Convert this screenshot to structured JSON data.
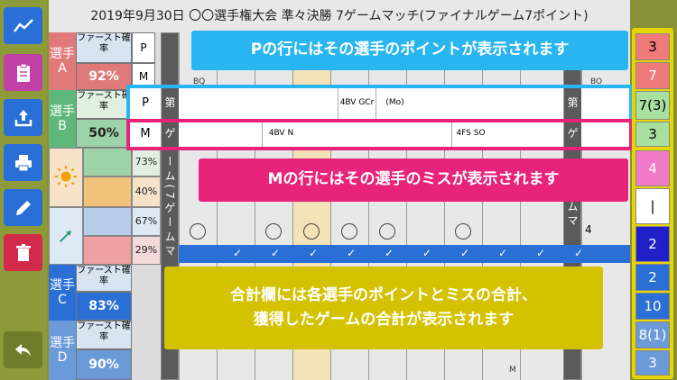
{
  "title": "2019年9月30日 〇〇選手権大会 準々決勝 7ゲームマッチ(ファイナルゲーム7ポイント)",
  "toolbar": {
    "colors": {
      "chart": "#2a6fd6",
      "clipboard": "#c040a8",
      "upload": "#2a6fd6",
      "print": "#2a6fd6",
      "pencil": "#2a6fd6",
      "trash": "#d22a4a",
      "back": "#7a8a2a"
    }
  },
  "players": [
    {
      "label": "選手A",
      "first_label": "ファースト確率",
      "rate": "92%",
      "p": "P",
      "m": "M",
      "rate_color": "#e07a7a"
    },
    {
      "label": "選手B",
      "first_label": "ファースト確率",
      "rate": "50%",
      "p": "P",
      "m": "M",
      "rate_color": "#5fb87a"
    },
    {
      "label": "選手C",
      "first_label": "ファースト確率",
      "rate": "83%",
      "p": "",
      "m": "",
      "rate_color": "#2a6fd6"
    },
    {
      "label": "選手D",
      "first_label": "ファースト確率",
      "rate": "90%",
      "p": "",
      "m": "",
      "rate_color": "#6a9ad8"
    }
  ],
  "game_label": "第1ゲーム(7ゲームマッチ)",
  "game_label_short": "第",
  "game_label_ge": "ゲ",
  "game_vertical": "ー ム ( 7 ゲ ー ム マ",
  "game_vertical_right": "ー ム マ",
  "cells": {
    "b_p_notes": [
      "4BV GCr",
      "(Mo)"
    ],
    "b_m_notes": [
      "4BV N",
      "4FS SO"
    ],
    "a_m_note": "BQ",
    "a_m_note2": "BO",
    "d_m_note": "M",
    "row_num": "4"
  },
  "percents": [
    "73%",
    "40%",
    "67%",
    "29%"
  ],
  "scores": [
    {
      "value": "3",
      "bg": "#f07a7a"
    },
    {
      "value": "7",
      "bg": "#f07a7a"
    },
    {
      "value": "7(3)",
      "bg": "#a8e0a0"
    },
    {
      "value": "3",
      "bg": "#a8e0a0"
    },
    {
      "value": "4",
      "bg": "#f07ac8"
    },
    {
      "value": "|",
      "bg": "#ffffff"
    },
    {
      "value": "2",
      "bg": "#2020c8"
    },
    {
      "value": "2",
      "bg": "#2a6fd6"
    },
    {
      "value": "10",
      "bg": "#2a6fd6"
    },
    {
      "value": "8(1)",
      "bg": "#6a9ad8"
    },
    {
      "value": "3",
      "bg": "#6a9ad8"
    }
  ],
  "callouts": {
    "p_row": "Pの行にはその選手のポイントが表示されます",
    "m_row": "Mの行にはその選手のミスが表示されます",
    "total_line1": "合計欄には各選手のポイントとミスの合計、",
    "total_line2": "獲得したゲームの合計が表示されます"
  }
}
